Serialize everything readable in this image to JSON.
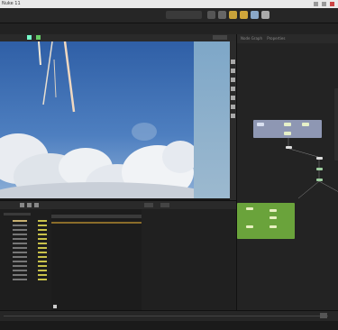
{
  "window": {
    "title": "Nuke 11"
  },
  "node_graph": {
    "tabs": [
      "Node Graph",
      "Properties"
    ]
  },
  "colors": {
    "node_green": "#6aa33b",
    "node_slate": "#8e97b3",
    "viewer_sky": "#3f6fb0",
    "bg": "#1b1b1b"
  },
  "icons": [
    "minimize-icon",
    "maximize-icon",
    "close-icon",
    "viewer-tool-icon",
    "play-icon",
    "node-icon"
  ]
}
